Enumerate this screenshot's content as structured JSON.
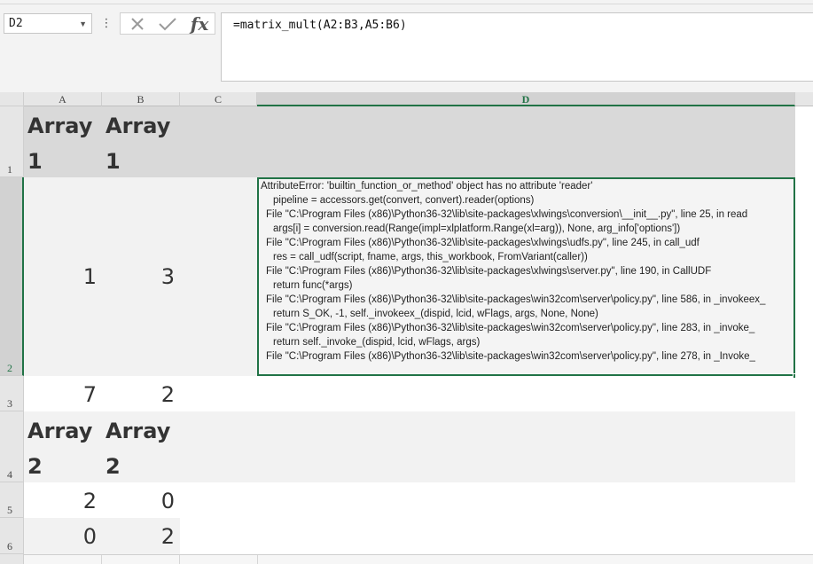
{
  "name_box": {
    "value": "D2",
    "dropdown_icon": "triangle-down-icon"
  },
  "formula_bar": {
    "more_icon": "vertical-dots-icon",
    "cancel_icon": "x-icon",
    "enter_icon": "check-icon",
    "function_label": "fx",
    "formula": "=matrix_mult(A2:B3,A5:B6)"
  },
  "columns": [
    "A",
    "B",
    "C",
    "D"
  ],
  "selected_column": "D",
  "rows": [
    "1",
    "2",
    "3",
    "4",
    "5",
    "6"
  ],
  "selected_row": "2",
  "cells": {
    "A1": "Array 1",
    "B1": "Array 1",
    "A2": "1",
    "B2": "3",
    "A3": "7",
    "B3": "2",
    "A4": "Array 2",
    "B4": "Array 2",
    "A5": "2",
    "B5": "0",
    "A6": "0",
    "B6": "2"
  },
  "error_lines": [
    "AttributeError: 'builtin_function_or_method' object has no attribute 'reader'",
    "pipeline = accessors.get(convert, convert).reader(options)",
    "File \"C:\\Program Files (x86)\\Python36-32\\lib\\site-packages\\xlwings\\conversion\\__init__.py\", line 25, in read",
    "args[i] = conversion.read(Range(impl=xlplatform.Range(xl=arg)), None, arg_info['options'])",
    "File \"C:\\Program Files (x86)\\Python36-32\\lib\\site-packages\\xlwings\\udfs.py\", line 245, in call_udf",
    "res = call_udf(script, fname, args, this_workbook, FromVariant(caller))",
    "File \"C:\\Program Files (x86)\\Python36-32\\lib\\site-packages\\xlwings\\server.py\", line 190, in CallUDF",
    "return func(*args)",
    "File \"C:\\Program Files (x86)\\Python36-32\\lib\\site-packages\\win32com\\server\\policy.py\", line 586, in _invokeex_",
    "return S_OK, -1, self._invokeex_(dispid, lcid, wFlags, args, None, None)",
    "File \"C:\\Program Files (x86)\\Python36-32\\lib\\site-packages\\win32com\\server\\policy.py\", line 283, in _invoke_",
    "return self._invoke_(dispid, lcid, wFlags, args)",
    "File \"C:\\Program Files (x86)\\Python36-32\\lib\\site-packages\\win32com\\server\\policy.py\", line 278, in _Invoke_"
  ],
  "colors": {
    "selection": "#217346",
    "header": "#e6e6e6",
    "band": "#d9d9d9"
  }
}
